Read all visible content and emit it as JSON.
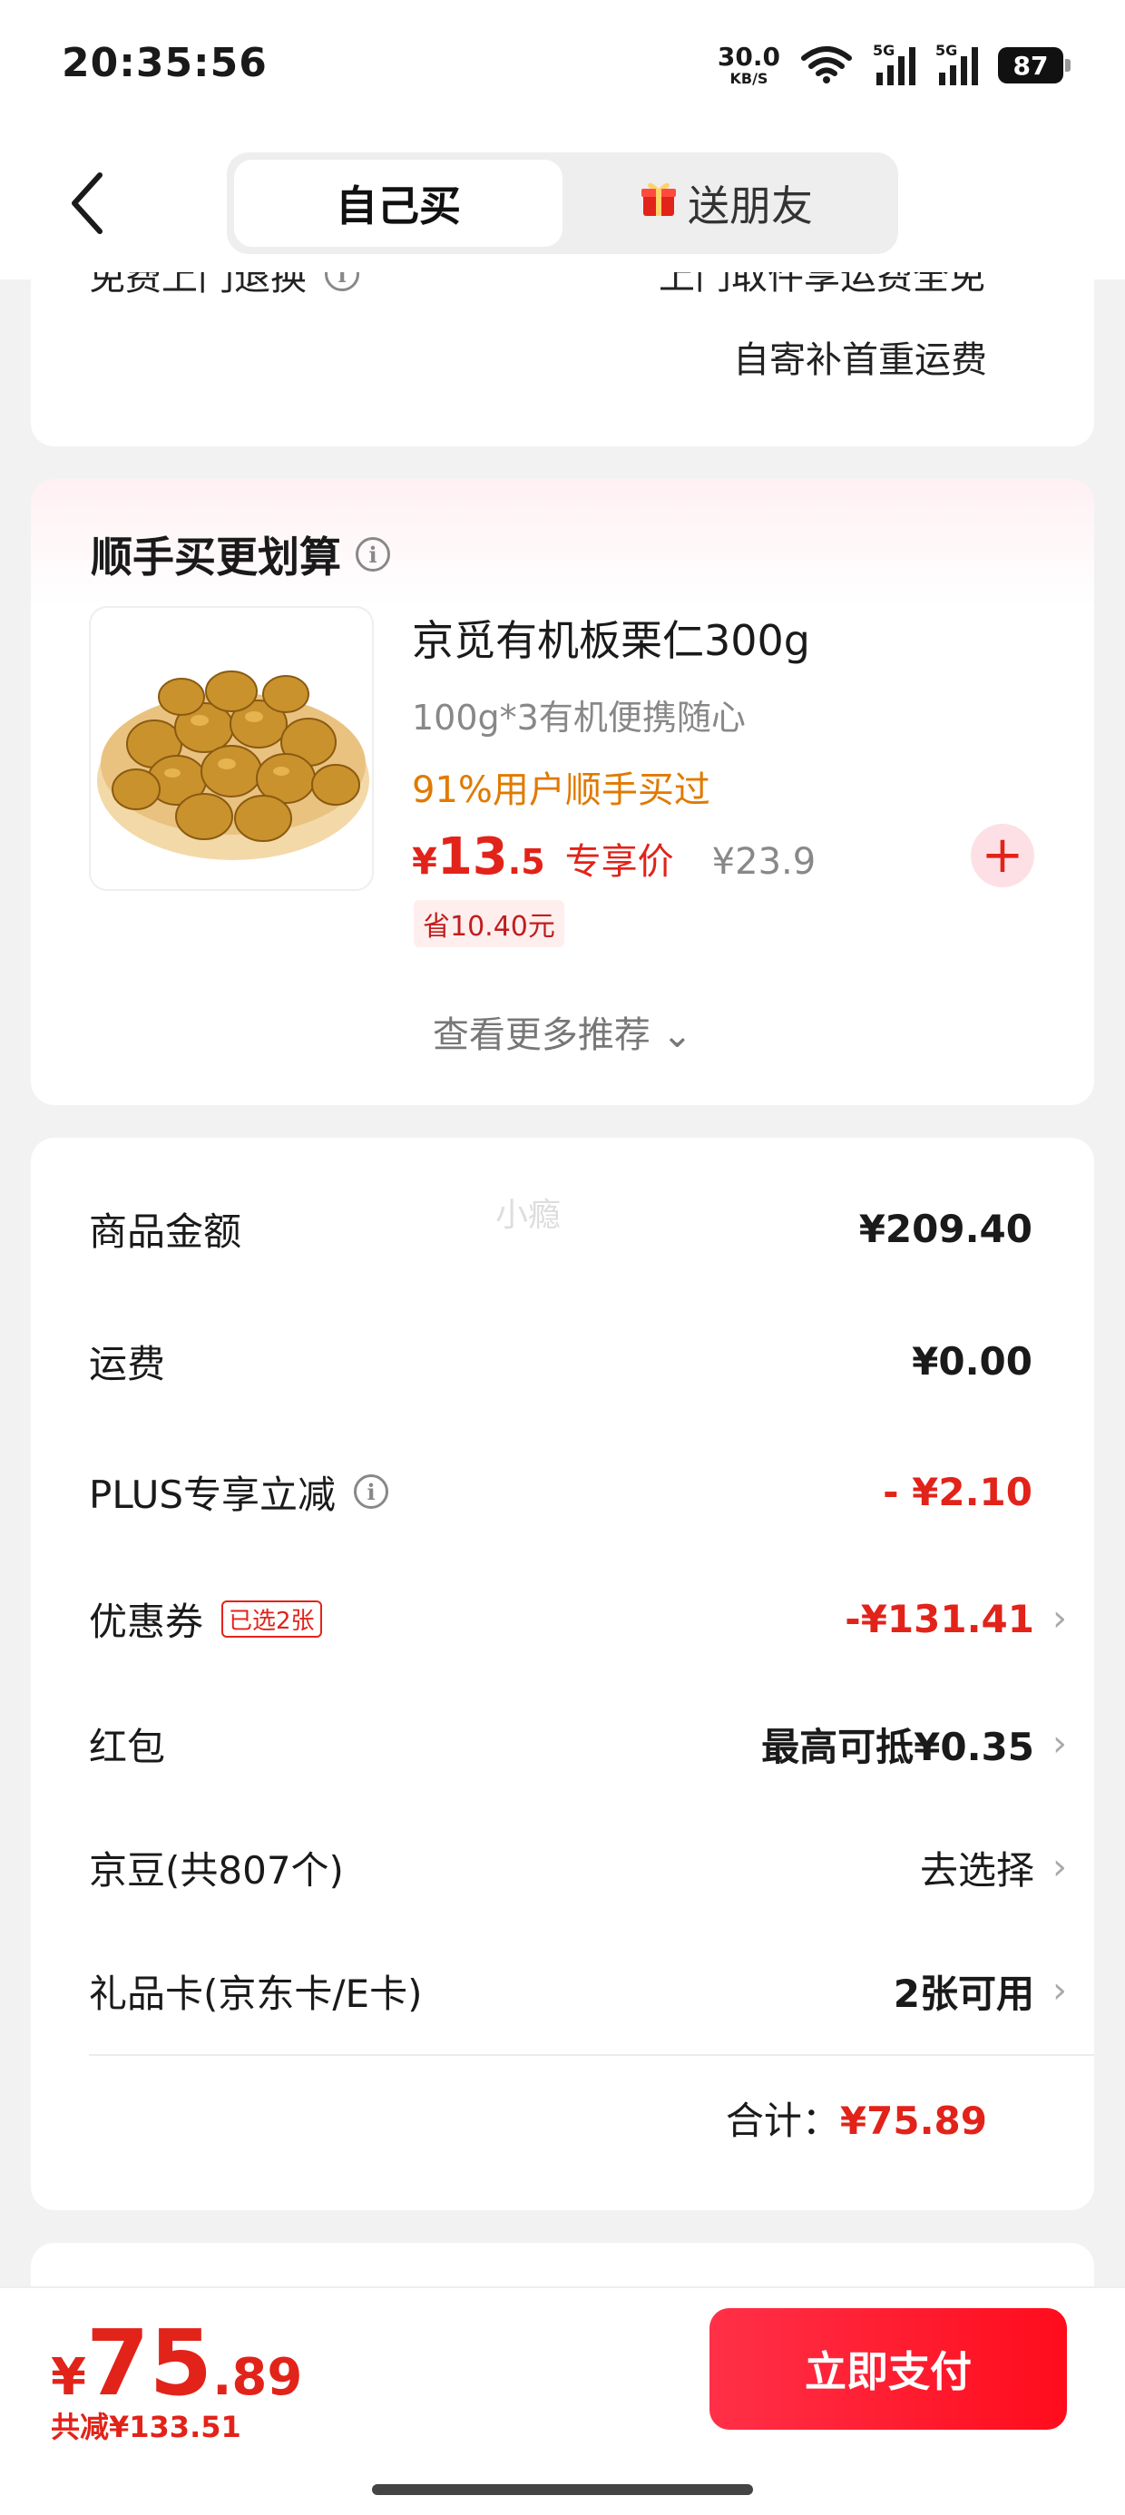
{
  "status_bar": {
    "time": "20:35:56",
    "net_speed_value": "30.0",
    "net_speed_unit": "KB/S",
    "signal_1_label": "5G",
    "signal_2_label": "5G",
    "battery": "87"
  },
  "header": {
    "tab_self": "自己买",
    "tab_gift": "送朋友",
    "gift_icon": "gift-icon"
  },
  "top_card": {
    "left_label": "免费上门退换",
    "right_line1": "上门取件享运费全免",
    "right_line2": "自寄补首重运费"
  },
  "recommend": {
    "title": "顺手买更划算",
    "product": {
      "name": "京觅有机板栗仁300g",
      "spec": "100g*3有机便携随心",
      "bought": "91%用户顺手买过",
      "price_symbol": "¥",
      "price_int": "13",
      "price_dec": ".5",
      "price_tag": "专享价",
      "original_price": "¥23.9",
      "save_badge": "省10.40元"
    },
    "more_link": "查看更多推荐 ⌄"
  },
  "summary": {
    "watermark": "小瘾",
    "rows": [
      {
        "label": "商品金额",
        "value": "¥209.40"
      },
      {
        "label": "运费",
        "value": "¥0.00"
      },
      {
        "label": "PLUS专享立减",
        "value": "- ¥2.10"
      },
      {
        "label": "优惠券",
        "badge": "已选2张",
        "value": "-¥131.41"
      },
      {
        "label": "红包",
        "value": "最高可抵¥0.35"
      },
      {
        "label": "京豆(共807个)",
        "value": "去选择"
      },
      {
        "label": "礼品卡(京东卡/E卡)",
        "value": "2张可用"
      }
    ],
    "chevron": "›",
    "total_label": "合计：",
    "total_value": "¥75.89"
  },
  "bottom_bar": {
    "price_symbol": "¥",
    "price_int": "75",
    "price_dec": ".89",
    "saved": "共减¥133.51",
    "pay_button": "立即支付"
  },
  "colors": {
    "accent_red": "#e2231a",
    "bought_orange": "#e07a00"
  }
}
